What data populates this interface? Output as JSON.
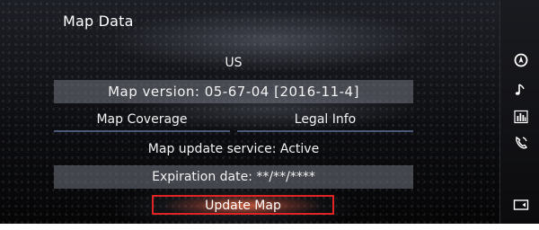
{
  "screen": {
    "title": "Map Data",
    "country": "US",
    "map_version": "Map version: 05-67-04  [2016-11-4]",
    "map_coverage_label": "Map Coverage",
    "legal_info_label": "Legal Info",
    "update_service": "Map update service: Active",
    "expiration": "Expiration date: **/**/****",
    "update_map_label": "Update Map"
  },
  "sidebar": {
    "icons": [
      "navigation-icon",
      "music-note-icon",
      "equalizer-icon",
      "phone-icon",
      "display-toggle-icon"
    ]
  },
  "colors": {
    "focus_border": "#e02424",
    "row_shade": "#737682"
  }
}
